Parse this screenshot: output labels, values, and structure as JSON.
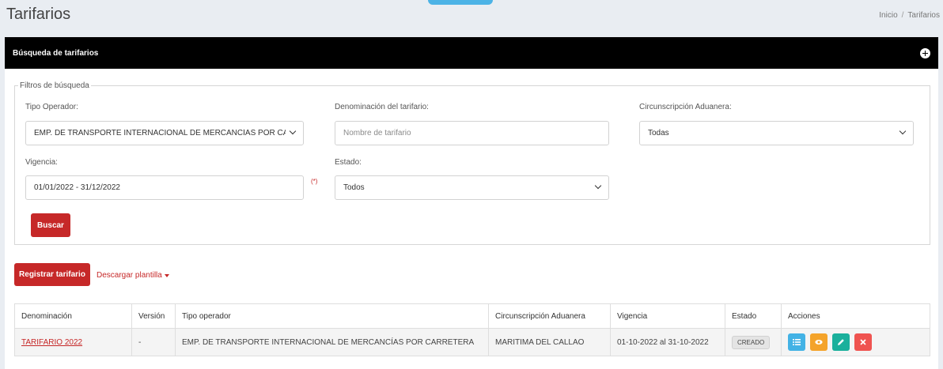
{
  "header": {
    "title": "Tarifarios",
    "breadcrumb": {
      "home": "Inicio",
      "separator": "/",
      "current": "Tarifarios"
    }
  },
  "panel": {
    "title": "Búsqueda de tarifarios",
    "toggle_icon": "collapse-plus-icon"
  },
  "filters": {
    "legend": "Filtros de búsqueda",
    "tipo_operador": {
      "label": "Tipo Operador:",
      "value": "EMP. DE TRANSPORTE INTERNACIONAL DE MERCANCÍAS POR CARRET"
    },
    "denominacion": {
      "label": "Denominación del tarifario:",
      "value": "",
      "placeholder": "Nombre de tarifario"
    },
    "circunscripcion": {
      "label": "Circunscripción Aduanera:",
      "value": "Todas"
    },
    "vigencia": {
      "label": "Vigencia:",
      "value": "01/01/2022 - 31/12/2022",
      "required_mark": "(*)"
    },
    "estado": {
      "label": "Estado:",
      "value": "Todos"
    },
    "search_button": "Buscar"
  },
  "toolbar": {
    "register_button": "Registrar tarifario",
    "download_link": "Descargar plantilla"
  },
  "table": {
    "columns": [
      "Denominación",
      "Versión",
      "Tipo operador",
      "Circunscripción Aduanera",
      "Vigencia",
      "Estado",
      "Acciones"
    ],
    "rows": [
      {
        "denominacion": "TARIFARIO 2022",
        "version": "-",
        "tipo_operador": "EMP. DE TRANSPORTE INTERNACIONAL DE MERCANCÍAS POR CARRETERA",
        "circunscripcion": "MARITIMA DEL CALLAO",
        "vigencia": "01-10-2022 al 31-10-2022",
        "estado": "CREADO",
        "actions": [
          "list-icon",
          "eye-icon",
          "pencil-icon",
          "close-icon"
        ]
      }
    ]
  },
  "colors": {
    "primary_red": "#c62828",
    "header_black": "#000000",
    "action_blue": "#43b2e5",
    "action_orange": "#f4a32a",
    "action_teal": "#1ab09c",
    "action_red": "#ef5350"
  }
}
